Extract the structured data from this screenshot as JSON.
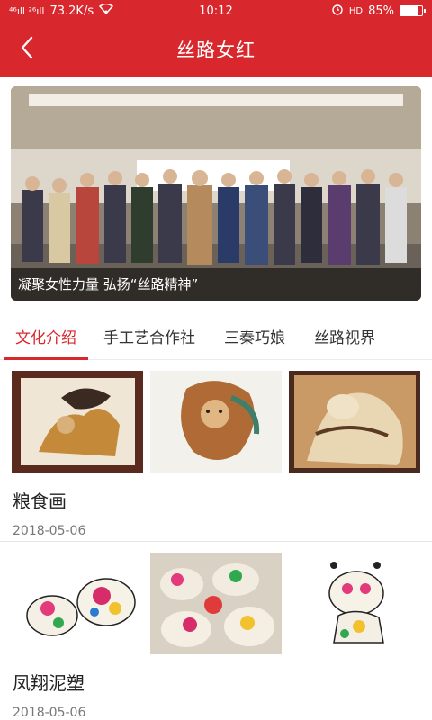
{
  "status": {
    "signal_text": "⁴⁶ıll ²⁶ıll",
    "speed": "73.2K/s",
    "time": "10:12",
    "battery_pct": "85%",
    "battery_level": 0.85,
    "icons": [
      "signal-icon",
      "wifi-icon",
      "alarm-icon",
      "volte-icon",
      "battery-icon"
    ]
  },
  "header": {
    "title": "丝路女红",
    "back_icon": "chevron-left-icon"
  },
  "banner": {
    "caption": "凝聚女性力量 弘扬“丝路精神”"
  },
  "tabs": [
    {
      "label": "文化介绍",
      "active": true
    },
    {
      "label": "手工艺合作社",
      "active": false
    },
    {
      "label": "三秦巧娘",
      "active": false
    },
    {
      "label": "丝路视界",
      "active": false
    }
  ],
  "articles": [
    {
      "title": "粮食画",
      "date": "2018-05-06"
    },
    {
      "title": "凤翔泥塑",
      "date": "2018-05-06"
    }
  ],
  "colors": {
    "brand": "#d9272e",
    "text": "#222222",
    "muted": "#777777"
  }
}
